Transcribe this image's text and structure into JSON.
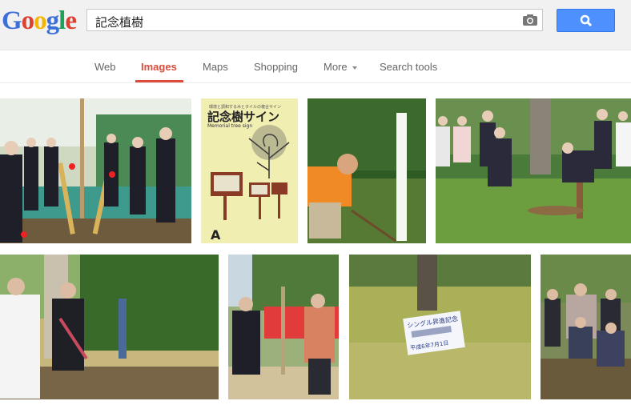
{
  "logo": [
    "G",
    "o",
    "o",
    "g",
    "l",
    "e"
  ],
  "search": {
    "query": "記念植樹"
  },
  "nav": {
    "tabs": [
      {
        "label": "Web"
      },
      {
        "label": "Images"
      },
      {
        "label": "Maps"
      },
      {
        "label": "Shopping"
      },
      {
        "label": "More"
      },
      {
        "label": "Search tools"
      }
    ],
    "active": "Images"
  },
  "images": {
    "row1": [
      {
        "desc": "ceremony-group-shovels"
      },
      {
        "desc": "memorial-tree-sign-poster"
      },
      {
        "desc": "man-orange-shirt-planting"
      },
      {
        "desc": "elderly-men-planting"
      }
    ],
    "row2": [
      {
        "desc": "priest-and-man-shrine"
      },
      {
        "desc": "two-men-planting-red-banner"
      },
      {
        "desc": "sign-in-grass"
      },
      {
        "desc": "group-seated-photo"
      }
    ],
    "poster": {
      "title_line": "環境と調和する木とタイルの複合サイン",
      "title": "記念樹サイン",
      "sub": "Memorial tree sign",
      "mark": "A"
    },
    "sign": {
      "line1": "シングル昇進記念",
      "line3": "平成6年7月1日"
    }
  },
  "colors": {
    "accent": "#dd4b39",
    "search_button": "#4d90fe"
  }
}
